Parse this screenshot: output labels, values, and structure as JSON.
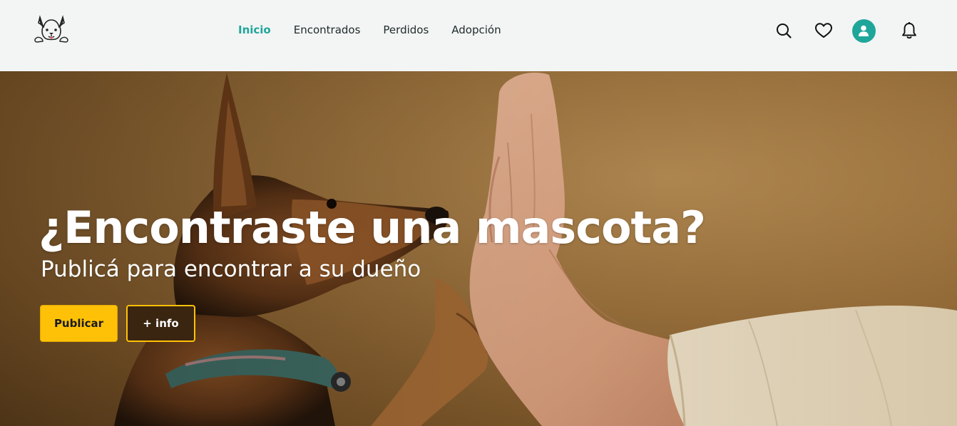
{
  "brand": {
    "logo_icon": "french-bulldog-logo"
  },
  "nav": {
    "links": [
      {
        "label": "Inicio",
        "active": true
      },
      {
        "label": "Encontrados",
        "active": false
      },
      {
        "label": "Perdidos",
        "active": false
      },
      {
        "label": "Adopción",
        "active": false
      }
    ],
    "icons": [
      "search-icon",
      "heart-icon",
      "user-icon",
      "bell-icon"
    ]
  },
  "hero": {
    "title": "¿Encontraste una mascota?",
    "subtitle": "Publicá para encontrar a su dueño",
    "primary_button": "Publicar",
    "secondary_button": "+ info",
    "background": "dog giving high five to human hand"
  },
  "colors": {
    "accent": "#1fa69a",
    "button_primary": "#ffc107",
    "nav_bg": "#f3f4f4",
    "hero_bg": "#9b723d"
  }
}
